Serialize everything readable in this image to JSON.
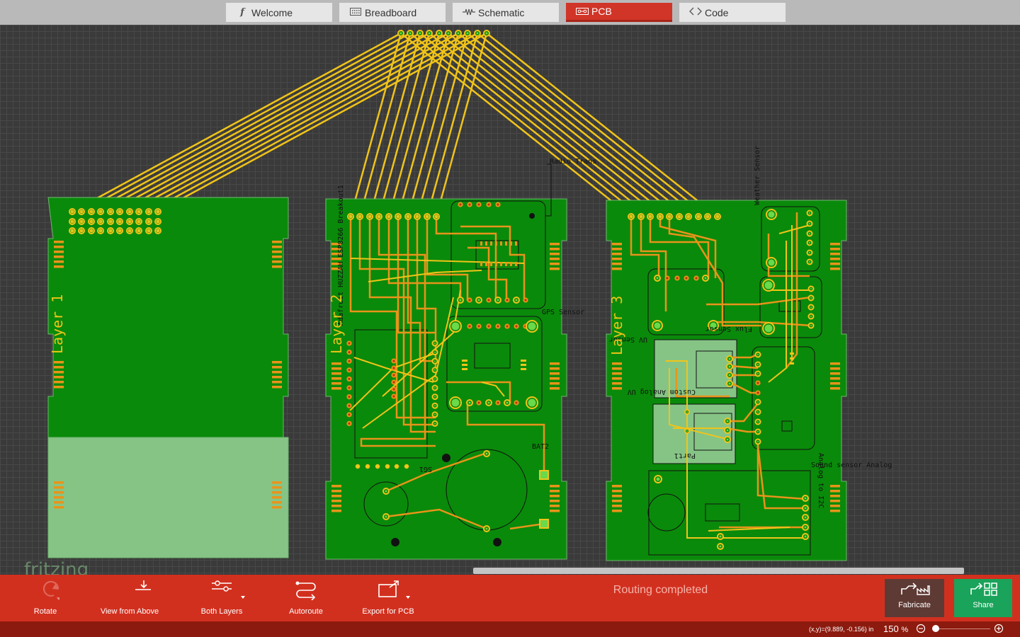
{
  "tabs": [
    {
      "label": "Welcome",
      "icon": "fritzing-f-icon",
      "active": false
    },
    {
      "label": "Breadboard",
      "icon": "breadboard-icon",
      "active": false
    },
    {
      "label": "Schematic",
      "icon": "schematic-icon",
      "active": false
    },
    {
      "label": "PCB",
      "icon": "pcb-icon",
      "active": true
    },
    {
      "label": "Code",
      "icon": "code-icon",
      "active": false
    }
  ],
  "canvas": {
    "layer_labels": [
      "Layer 1",
      "Layer 2",
      "Layer 3"
    ],
    "silkscreen_labels": {
      "huzzah": "Adafruit HUZZAH ESP8266 Breakout1",
      "radio": "Radio Trans",
      "gps": "GPS Sensor",
      "bat": "BAT2",
      "sg1": "SG1",
      "weather": "Weather Sensor",
      "flux": "Flux Sensor",
      "uv": "UV Sensor",
      "custom_uv": "Custom Analog UV",
      "part1": "Part1",
      "sound": "Sound sensor Analog",
      "i2c": "Analog to I2C"
    },
    "logo": "fritzing"
  },
  "toolbar": {
    "rotate": "Rotate",
    "view_from_above": "View from Above",
    "both_layers": "Both Layers",
    "autoroute": "Autoroute",
    "export_pcb": "Export for PCB"
  },
  "status_message": "Routing completed",
  "actions": {
    "fabricate": "Fabricate",
    "share": "Share"
  },
  "statusbar": {
    "coordinates": "(x,y)=(9.889, -0.156) in",
    "zoom_level": "150",
    "zoom_unit": "%"
  },
  "colors": {
    "board_green": "#0a8a0a",
    "trace_orange": "#e8941a",
    "trace_yellow": "#f0c419",
    "pad_green": "#6ad94a",
    "toolbar_red": "#d2301f",
    "active_tab": "#d03528",
    "share_green": "#1aa35a",
    "fabricate_brown": "#5e3a34"
  }
}
